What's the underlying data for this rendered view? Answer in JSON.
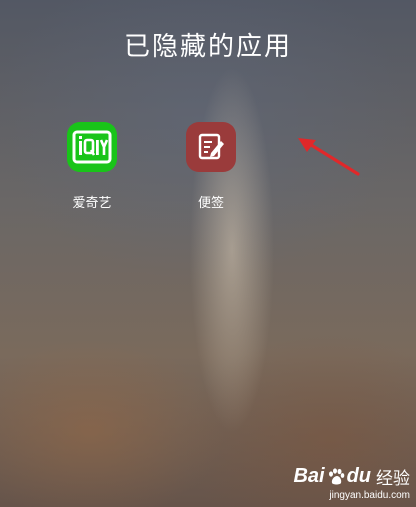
{
  "screen": {
    "title": "已隐藏的应用"
  },
  "apps": [
    {
      "label": "爱奇艺",
      "icon": "iqiyi-icon",
      "color": "#19c419"
    },
    {
      "label": "便签",
      "icon": "notes-icon",
      "color": "#9a3b3b"
    }
  ],
  "annotation": {
    "arrow_color": "#e0282a"
  },
  "watermark": {
    "brand_prefix": "Bai",
    "brand_suffix": "du",
    "service": "经验",
    "url": "jingyan.baidu.com"
  }
}
